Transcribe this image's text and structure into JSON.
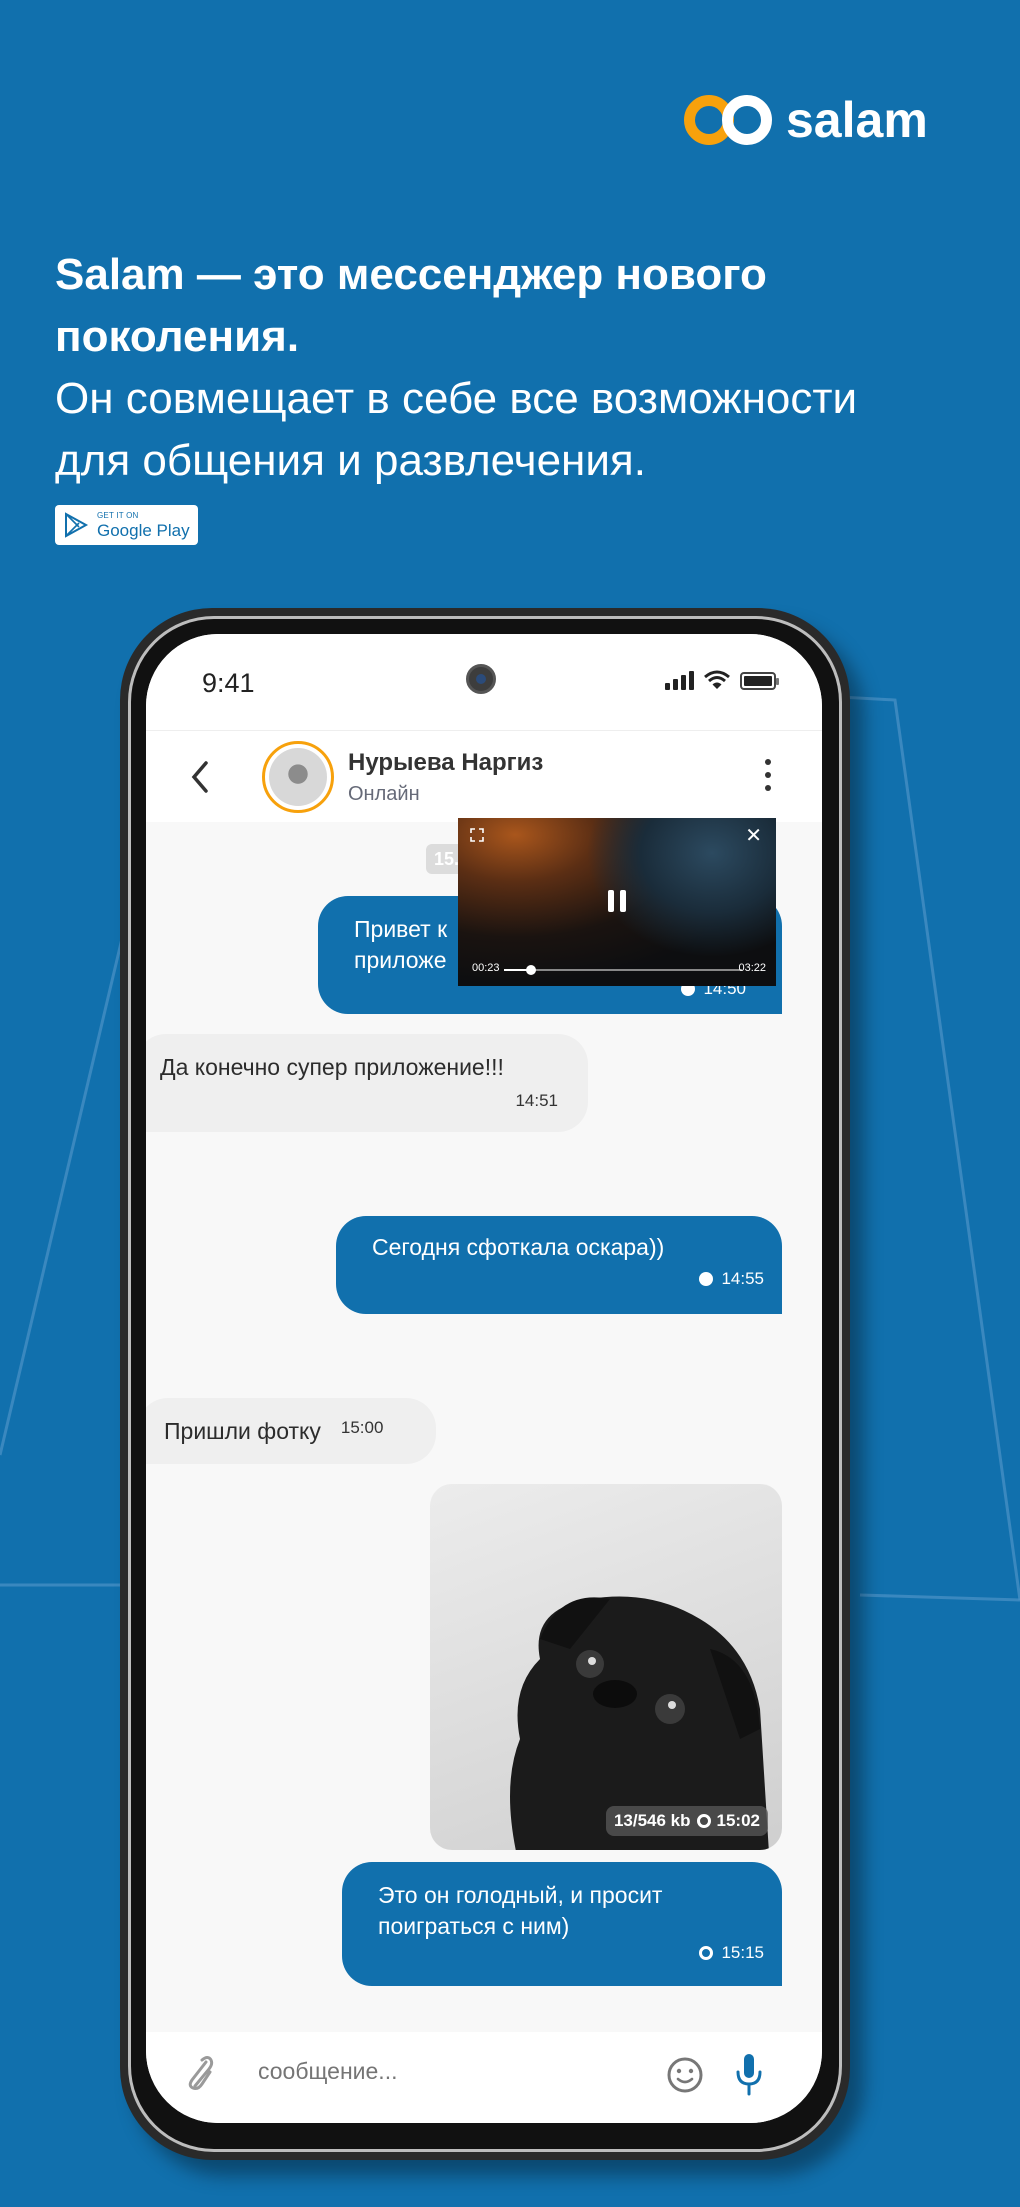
{
  "brand": {
    "name": "salam",
    "colors": {
      "primary": "#1170ad",
      "accent": "#f7a10c",
      "incoming_bubble": "#efefef",
      "chat_bg": "#f8f8f8"
    }
  },
  "promo": {
    "headline_bold_1": "Salam — это мессенджер нового",
    "headline_bold_2": "поколения.",
    "headline_line_1": "Он совмещает в себе все возможности",
    "headline_line_2": "для  общения и развлечения.",
    "store_badge": {
      "small": "GET IT ON",
      "large": "Google Play",
      "icon": "google-play-icon"
    }
  },
  "status_bar": {
    "time": "9:41",
    "icons": [
      "signal-icon",
      "wifi-icon",
      "battery-icon"
    ]
  },
  "chat_header": {
    "contact_name": "Нурыева Наргиз",
    "contact_status": "Онлайн",
    "icons": [
      "back-icon",
      "avatar",
      "more-vertical-icon"
    ]
  },
  "date_chip": "15.",
  "video_player": {
    "current_time": "00:23",
    "total_time": "03:22",
    "progress_fraction": 0.114,
    "state": "playing",
    "icons": [
      "expand-icon",
      "pause-icon",
      "close-icon"
    ]
  },
  "messages": [
    {
      "direction": "out",
      "text_line_1": "Привет к",
      "text_line_2": "приложе",
      "time": "14:50",
      "status_icon": "sent-dot-icon"
    },
    {
      "direction": "in",
      "text": "Да конечно супер приложение!!!",
      "time": "14:51"
    },
    {
      "direction": "out",
      "text": "Сегодня сфоткала оскара))",
      "time": "14:55",
      "status_icon": "sent-dot-icon"
    },
    {
      "direction": "in",
      "text": "Пришли фотку",
      "time": "15:00"
    },
    {
      "direction": "out",
      "type": "photo",
      "size": "13/546 kb",
      "time": "15:02",
      "status_icon": "pending-ring-icon"
    },
    {
      "direction": "out",
      "text_line_1": "Это он голодный, и просит",
      "text_line_2": "поиграться с ним)",
      "time": "15:15",
      "status_icon": "pending-ring-icon"
    }
  ],
  "composer": {
    "placeholder": "сообщение...",
    "value": "",
    "icons": [
      "attach-icon",
      "emoji-icon",
      "mic-icon"
    ]
  }
}
